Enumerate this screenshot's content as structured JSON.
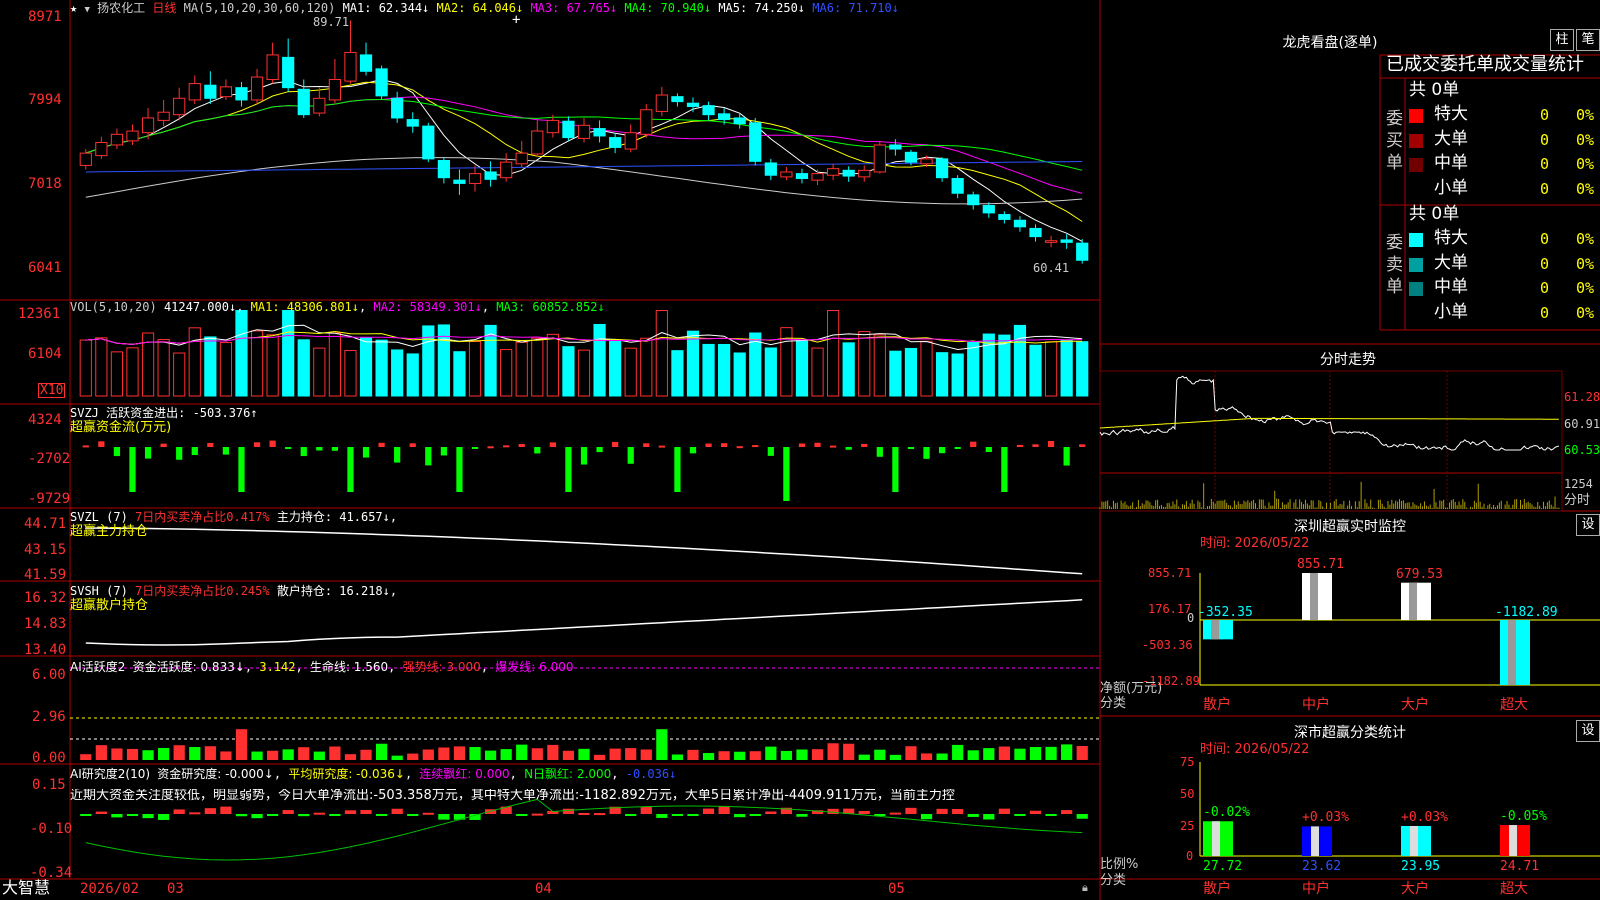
{
  "stock": {
    "star": "★",
    "name": "扬农化工",
    "period": "日线",
    "ma_prefix": "MA(5,10,20,30,60,120)",
    "ma": [
      {
        "label": "MA1: 62.344↓",
        "color": "#ffffff"
      },
      {
        "label": "MA2: 64.046↓",
        "color": "#ffff00"
      },
      {
        "label": "MA3: 67.765↓",
        "color": "#ff00ff"
      },
      {
        "label": "MA4: 70.940↓",
        "color": "#00ff00"
      },
      {
        "label": "MA5: 74.250↓",
        "color": "#ffffff"
      },
      {
        "label": "MA6: 71.710↓",
        "color": "#0000ff"
      }
    ],
    "price_ticks": [
      "8971",
      "7994",
      "7018",
      "6041"
    ],
    "high_mark": "89.71",
    "low_mark": "60.41",
    "cross_mark": "+"
  },
  "volume": {
    "header": "VOL(5,10,20)",
    "value": "41247.000↓",
    "ma": [
      {
        "label": "MA1: 48306.801↓",
        "color": "#ffffff"
      },
      {
        "label": "MA2: 58349.301↓",
        "color": "#ff00ff"
      },
      {
        "label": "MA3: 60852.852↓",
        "color": "#00ff00"
      }
    ],
    "ticks": [
      "12361",
      "6104"
    ],
    "unit": "X10"
  },
  "svzj": {
    "header": "SVZJ  活跃资金进出: -503.376↑",
    "subtitle": "超赢资金流(万元)",
    "ticks": [
      "4324",
      "-2702",
      "-9729"
    ]
  },
  "svzl": {
    "header_code": "SVZL (7)",
    "header_pct": "7日内买卖净占比0.417%",
    "header_val": "主力持仓: 41.657↓",
    "subtitle": "超赢主力持仓",
    "ticks": [
      "44.71",
      "43.15",
      "41.59"
    ]
  },
  "svsh": {
    "header_code": "SVSH (7)",
    "header_pct": "7日内买卖净占比0.245%",
    "header_val": "散户持仓: 16.218↓",
    "subtitle": "超赢散户持仓",
    "ticks": [
      "16.32",
      "14.83",
      "13.40"
    ]
  },
  "ai_active": {
    "header_a": "AI活跃度2",
    "header_b": "资金活跃度: 0.833↓",
    "header_c": "3.142",
    "header_d": "生命线: 1.560",
    "header_e": "强势线: 3.000",
    "header_f": "爆发线: 6.000",
    "ticks": [
      "6.00",
      "2.96",
      "0.00"
    ]
  },
  "ai_research": {
    "header_a": "AI研究度2(10)",
    "header_b": "资金研究度: -0.000↓",
    "header_c": "平均研究度: -0.036↓",
    "header_d": "连续飘红: 0.000",
    "header_e": "N日飘红: 2.000",
    "header_f": "-0.036↓",
    "comment": "近期大资金关注度较低，明显弱势，今日大单净流出:-503.358万元，其中特大单净流出:-1182.892万元，大单5日累计净出-4409.911万元，当前主力控",
    "ticks": [
      "0.15",
      "-0.10",
      "-0.34"
    ]
  },
  "bottom_bar": {
    "brand": "大智慧",
    "dates": [
      "2026/02",
      "03",
      "04",
      "05"
    ]
  },
  "right": {
    "lhb_title": "龙虎看盘(逐单)",
    "btn_zhu": "柱",
    "btn_bi": "笔",
    "tabs": [
      "已成交",
      "委托单",
      "成交量统计"
    ],
    "buy_label": "委买单",
    "sell_label": "委卖单",
    "buy_total": "共 0单",
    "sell_total": "共 0单",
    "buy_rows": [
      {
        "name": "特大",
        "count": "0",
        "pct": "0%",
        "color": "#ff0000"
      },
      {
        "name": "大单",
        "count": "0",
        "pct": "0%",
        "color": "#a00000"
      },
      {
        "name": "中单",
        "count": "0",
        "pct": "0%",
        "color": "#700000"
      },
      {
        "name": "小单",
        "count": "0",
        "pct": "0%",
        "color": "#000000"
      }
    ],
    "sell_rows": [
      {
        "name": "特大",
        "count": "0",
        "pct": "0%",
        "color": "#00ffff"
      },
      {
        "name": "大单",
        "count": "0",
        "pct": "0%",
        "color": "#00a0a0"
      },
      {
        "name": "中单",
        "count": "0",
        "pct": "0%",
        "color": "#008080"
      },
      {
        "name": "小单",
        "count": "0",
        "pct": "0%",
        "color": "#000000"
      }
    ],
    "intraday_title": "分时走势",
    "intraday_ticks": [
      "61.28",
      "60.91",
      "60.53"
    ],
    "intraday_vol_tick": "1254",
    "intraday_vol_label": "分时",
    "monitor_title": "深圳超赢实时监控",
    "monitor_btn": "设",
    "monitor_time": "时间: 2026/05/22",
    "monitor_ticks": [
      "855.71",
      "176.17",
      "0",
      "-503.36",
      "-1182.89"
    ],
    "monitor_ylabel_a": "净额(万元)",
    "monitor_ylabel_b": "分类",
    "monitor_bars": [
      {
        "cat": "散户",
        "value": -352.35,
        "label": "-352.35",
        "color": "#00ffff"
      },
      {
        "cat": "中户",
        "value": 855.71,
        "label": "855.71",
        "color": "#ffffff"
      },
      {
        "cat": "大户",
        "value": 679.53,
        "label": "679.53",
        "color": "#ffffff"
      },
      {
        "cat": "超大",
        "value": -1182.89,
        "label": "-1182.89",
        "color": "#00ffff"
      }
    ],
    "stat_title": "深市超赢分类统计",
    "stat_btn": "设",
    "stat_time": "时间: 2026/05/22",
    "stat_ticks": [
      "75",
      "50",
      "25",
      "0"
    ],
    "stat_ylabel_a": "比例%",
    "stat_ylabel_b": "分类",
    "stat_bars": [
      {
        "cat": "散户",
        "value": 27.72,
        "label": "27.72",
        "change": "-0.02%",
        "color": "#00ff00",
        "change_color": "#00ff00"
      },
      {
        "cat": "中户",
        "value": 23.62,
        "label": "23.62",
        "change": "+0.03%",
        "color": "#0000ff",
        "change_color": "#ff3030"
      },
      {
        "cat": "大户",
        "value": 23.95,
        "label": "23.95",
        "change": "+0.03%",
        "color": "#00ffff",
        "change_color": "#ff3030"
      },
      {
        "cat": "超大",
        "value": 24.71,
        "label": "24.71",
        "change": "-0.05%",
        "color": "#ff0000",
        "change_color": "#00ff00"
      }
    ]
  },
  "chart_data": {
    "type": "candlestick",
    "dates_shown": [
      "2026/02",
      "03",
      "04",
      "05"
    ],
    "price_range": [
      60.41,
      89.71
    ],
    "candles": [
      [
        72,
        73.5,
        71.5,
        74
      ],
      [
        73.2,
        74.8,
        72.8,
        75.5
      ],
      [
        74.5,
        75.8,
        74,
        76.5
      ],
      [
        75,
        76.2,
        74.5,
        77
      ],
      [
        76,
        77.8,
        75.2,
        79
      ],
      [
        77.5,
        78.5,
        76.8,
        80
      ],
      [
        78.2,
        80.2,
        77.5,
        81.5
      ],
      [
        80,
        82,
        79.5,
        83
      ],
      [
        81.8,
        80.2,
        79.5,
        83.5
      ],
      [
        80.4,
        81.6,
        80,
        82.5
      ],
      [
        81.5,
        80,
        79.2,
        82.2
      ],
      [
        80,
        82.8,
        79.5,
        83.8
      ],
      [
        82.5,
        85.5,
        82,
        87
      ],
      [
        85.2,
        81.5,
        81,
        87.5
      ],
      [
        81.3,
        78.2,
        77.8,
        82.5
      ],
      [
        78.4,
        80.2,
        78,
        81.5
      ],
      [
        80,
        82.5,
        79.6,
        85
      ],
      [
        82.3,
        85.8,
        82,
        89.71
      ],
      [
        85.5,
        83.5,
        83,
        87
      ],
      [
        83.8,
        80.5,
        80,
        84.2
      ],
      [
        80.2,
        77.8,
        77.2,
        81
      ],
      [
        77.6,
        76.8,
        76,
        78.5
      ],
      [
        76.8,
        72.8,
        72.4,
        77.2
      ],
      [
        72.6,
        70.5,
        69.8,
        73
      ],
      [
        70.2,
        69.8,
        68.4,
        71.5
      ],
      [
        69.8,
        71,
        68.8,
        72
      ],
      [
        71.2,
        70.3,
        69.4,
        72.5
      ],
      [
        70.5,
        72.4,
        70,
        73.5
      ],
      [
        72.2,
        73.5,
        71.8,
        75
      ],
      [
        73.4,
        76.2,
        73,
        77.5
      ],
      [
        76,
        77.5,
        75.4,
        78.2
      ],
      [
        77.4,
        75.4,
        75,
        78
      ],
      [
        75.3,
        76.9,
        74.8,
        77.8
      ],
      [
        76.5,
        75.6,
        74.8,
        77.5
      ],
      [
        75.4,
        74.2,
        73.5,
        76
      ],
      [
        74,
        76,
        73.6,
        77
      ],
      [
        75.8,
        78.8,
        75.4,
        79.5
      ],
      [
        78.6,
        80.6,
        78,
        81.6
      ],
      [
        80.4,
        79.8,
        79.2,
        80.8
      ],
      [
        79.6,
        79.2,
        78.5,
        80.3
      ],
      [
        79.3,
        78.2,
        77.5,
        79.8
      ],
      [
        78.3,
        77.6,
        77,
        79
      ],
      [
        77.8,
        77.1,
        76.5,
        78.4
      ],
      [
        77.2,
        72.5,
        72,
        77.8
      ],
      [
        72.3,
        70.8,
        70.2,
        72.8
      ],
      [
        70.6,
        71.2,
        70.2,
        71.8
      ],
      [
        71,
        70.4,
        69.8,
        71.6
      ],
      [
        70.2,
        71,
        69.6,
        71.5
      ],
      [
        70.8,
        71.6,
        70.2,
        72.2
      ],
      [
        71.4,
        70.7,
        70,
        71.9
      ],
      [
        70.6,
        71.4,
        70,
        72
      ],
      [
        71.2,
        74.5,
        71,
        75
      ],
      [
        74.5,
        74,
        73.2,
        75.2
      ],
      [
        73.6,
        72.4,
        72,
        73.9
      ],
      [
        72.2,
        72.8,
        71.8,
        73.2
      ],
      [
        72.8,
        70.5,
        70,
        73
      ],
      [
        70.4,
        68.6,
        68,
        70.8
      ],
      [
        68.4,
        67.2,
        66.6,
        68.8
      ],
      [
        67.1,
        66.2,
        65.6,
        67.5
      ],
      [
        66,
        65.4,
        64.9,
        66.4
      ],
      [
        65.3,
        64.5,
        63.9,
        65.8
      ],
      [
        64.3,
        63.3,
        62.7,
        64.8
      ],
      [
        62.6,
        62.8,
        62,
        63.4
      ],
      [
        62.9,
        62.6,
        61.8,
        63.6
      ],
      [
        62.5,
        60.41,
        60,
        63
      ]
    ]
  }
}
